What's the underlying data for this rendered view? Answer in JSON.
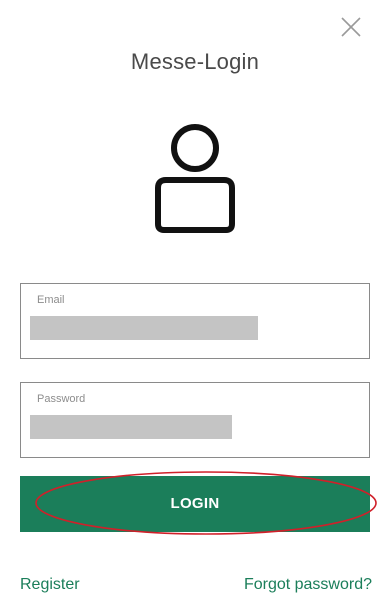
{
  "dialog": {
    "title": "Messe-Login",
    "close_icon": "close-icon",
    "user_icon": "user-icon"
  },
  "form": {
    "email": {
      "label": "Email",
      "value": ""
    },
    "password": {
      "label": "Password",
      "value": ""
    },
    "login_label": "LOGIN"
  },
  "links": {
    "register": "Register",
    "forgot_password": "Forgot password?"
  },
  "colors": {
    "accent": "#1b7e5a",
    "highlight": "#d0202a",
    "redacted": "#c4c4c4"
  }
}
